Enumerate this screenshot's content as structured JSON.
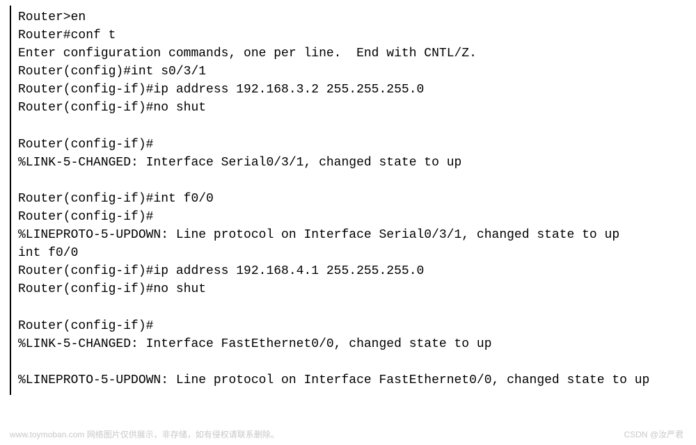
{
  "terminal": {
    "lines": [
      "Router>en",
      "Router#conf t",
      "Enter configuration commands, one per line.  End with CNTL/Z.",
      "Router(config)#int s0/3/1",
      "Router(config-if)#ip address 192.168.3.2 255.255.255.0",
      "Router(config-if)#no shut",
      "",
      "Router(config-if)#",
      "%LINK-5-CHANGED: Interface Serial0/3/1, changed state to up",
      "",
      "Router(config-if)#int f0/0",
      "Router(config-if)#",
      "%LINEPROTO-5-UPDOWN: Line protocol on Interface Serial0/3/1, changed state to up",
      "int f0/0",
      "Router(config-if)#ip address 192.168.4.1 255.255.255.0",
      "Router(config-if)#no shut",
      "",
      "Router(config-if)#",
      "%LINK-5-CHANGED: Interface FastEthernet0/0, changed state to up",
      "",
      "%LINEPROTO-5-UPDOWN: Line protocol on Interface FastEthernet0/0, changed state to up"
    ]
  },
  "watermark": {
    "left": "www.toymoban.com 网络图片仅供展示，非存储，如有侵权请联系删除。",
    "right": "CSDN @汝严君"
  }
}
